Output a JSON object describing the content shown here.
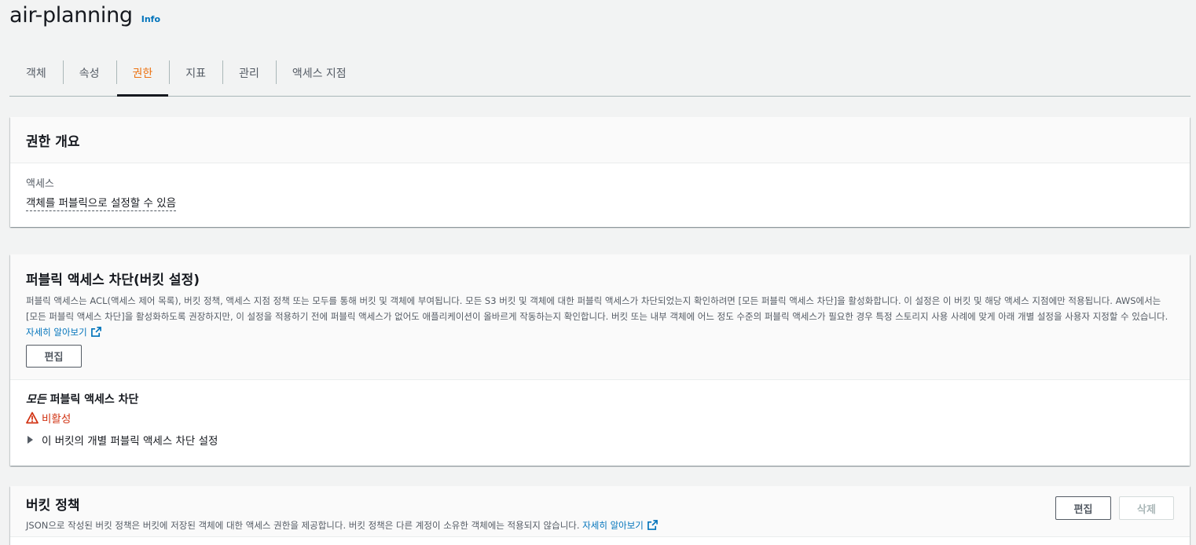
{
  "header": {
    "title": "air-planning",
    "info": "Info"
  },
  "tabs": [
    {
      "label": "객체",
      "active": false
    },
    {
      "label": "속성",
      "active": false
    },
    {
      "label": "권한",
      "active": true
    },
    {
      "label": "지표",
      "active": false
    },
    {
      "label": "관리",
      "active": false
    },
    {
      "label": "액세스 지점",
      "active": false
    }
  ],
  "overview": {
    "title": "권한 개요",
    "access_label": "액세스",
    "access_value": "객체를 퍼블릭으로 설정할 수 있음"
  },
  "block_public": {
    "title": "퍼블릭 액세스 차단(버킷 설정)",
    "description": "퍼블릭 액세스는 ACL(액세스 제어 목록), 버킷 정책, 액세스 지점 정책 또는 모두를 통해 버킷 및 객체에 부여됩니다. 모든 S3 버킷 및 객체에 대한 퍼블릭 액세스가 차단되었는지 확인하려면 [모든 퍼블릭 액세스 차단]을 활성화합니다. 이 설정은 이 버킷 및 해당 액세스 지점에만 적용됩니다. AWS에서는 [모든 퍼블릭 액세스 차단]을 활성화하도록 권장하지만, 이 설정을 적용하기 전에 퍼블릭 액세스가 없어도 애플리케이션이 올바르게 작동하는지 확인합니다. 버킷 또는 내부 객체에 어느 정도 수준의 퍼블릭 액세스가 필요한 경우 특정 스토리지 사용 사례에 맞게 아래 개별 설정을 사용자 지정할 수 있습니다.",
    "learn_more": "자세히 알아보기",
    "edit_button": "편집",
    "all_label_em": "모든",
    "all_label_rest": " 퍼블릭 액세스 차단",
    "status": "비활성",
    "status_color": "#d13212",
    "expander": "이 버킷의 개별 퍼블릭 액세스 차단 설정"
  },
  "bucket_policy": {
    "title": "버킷 정책",
    "description": "JSON으로 작성된 버킷 정책은 버킷에 저장된 객체에 대한 액세스 권한을 제공합니다. 버킷 정책은 다른 계정이 소유한 객체에는 적용되지 않습니다.",
    "learn_more": "자세히 알아보기",
    "edit_button": "편집",
    "delete_button": "삭제"
  },
  "colors": {
    "accent": "#ec7211",
    "link": "#0073bb",
    "error": "#d13212"
  }
}
